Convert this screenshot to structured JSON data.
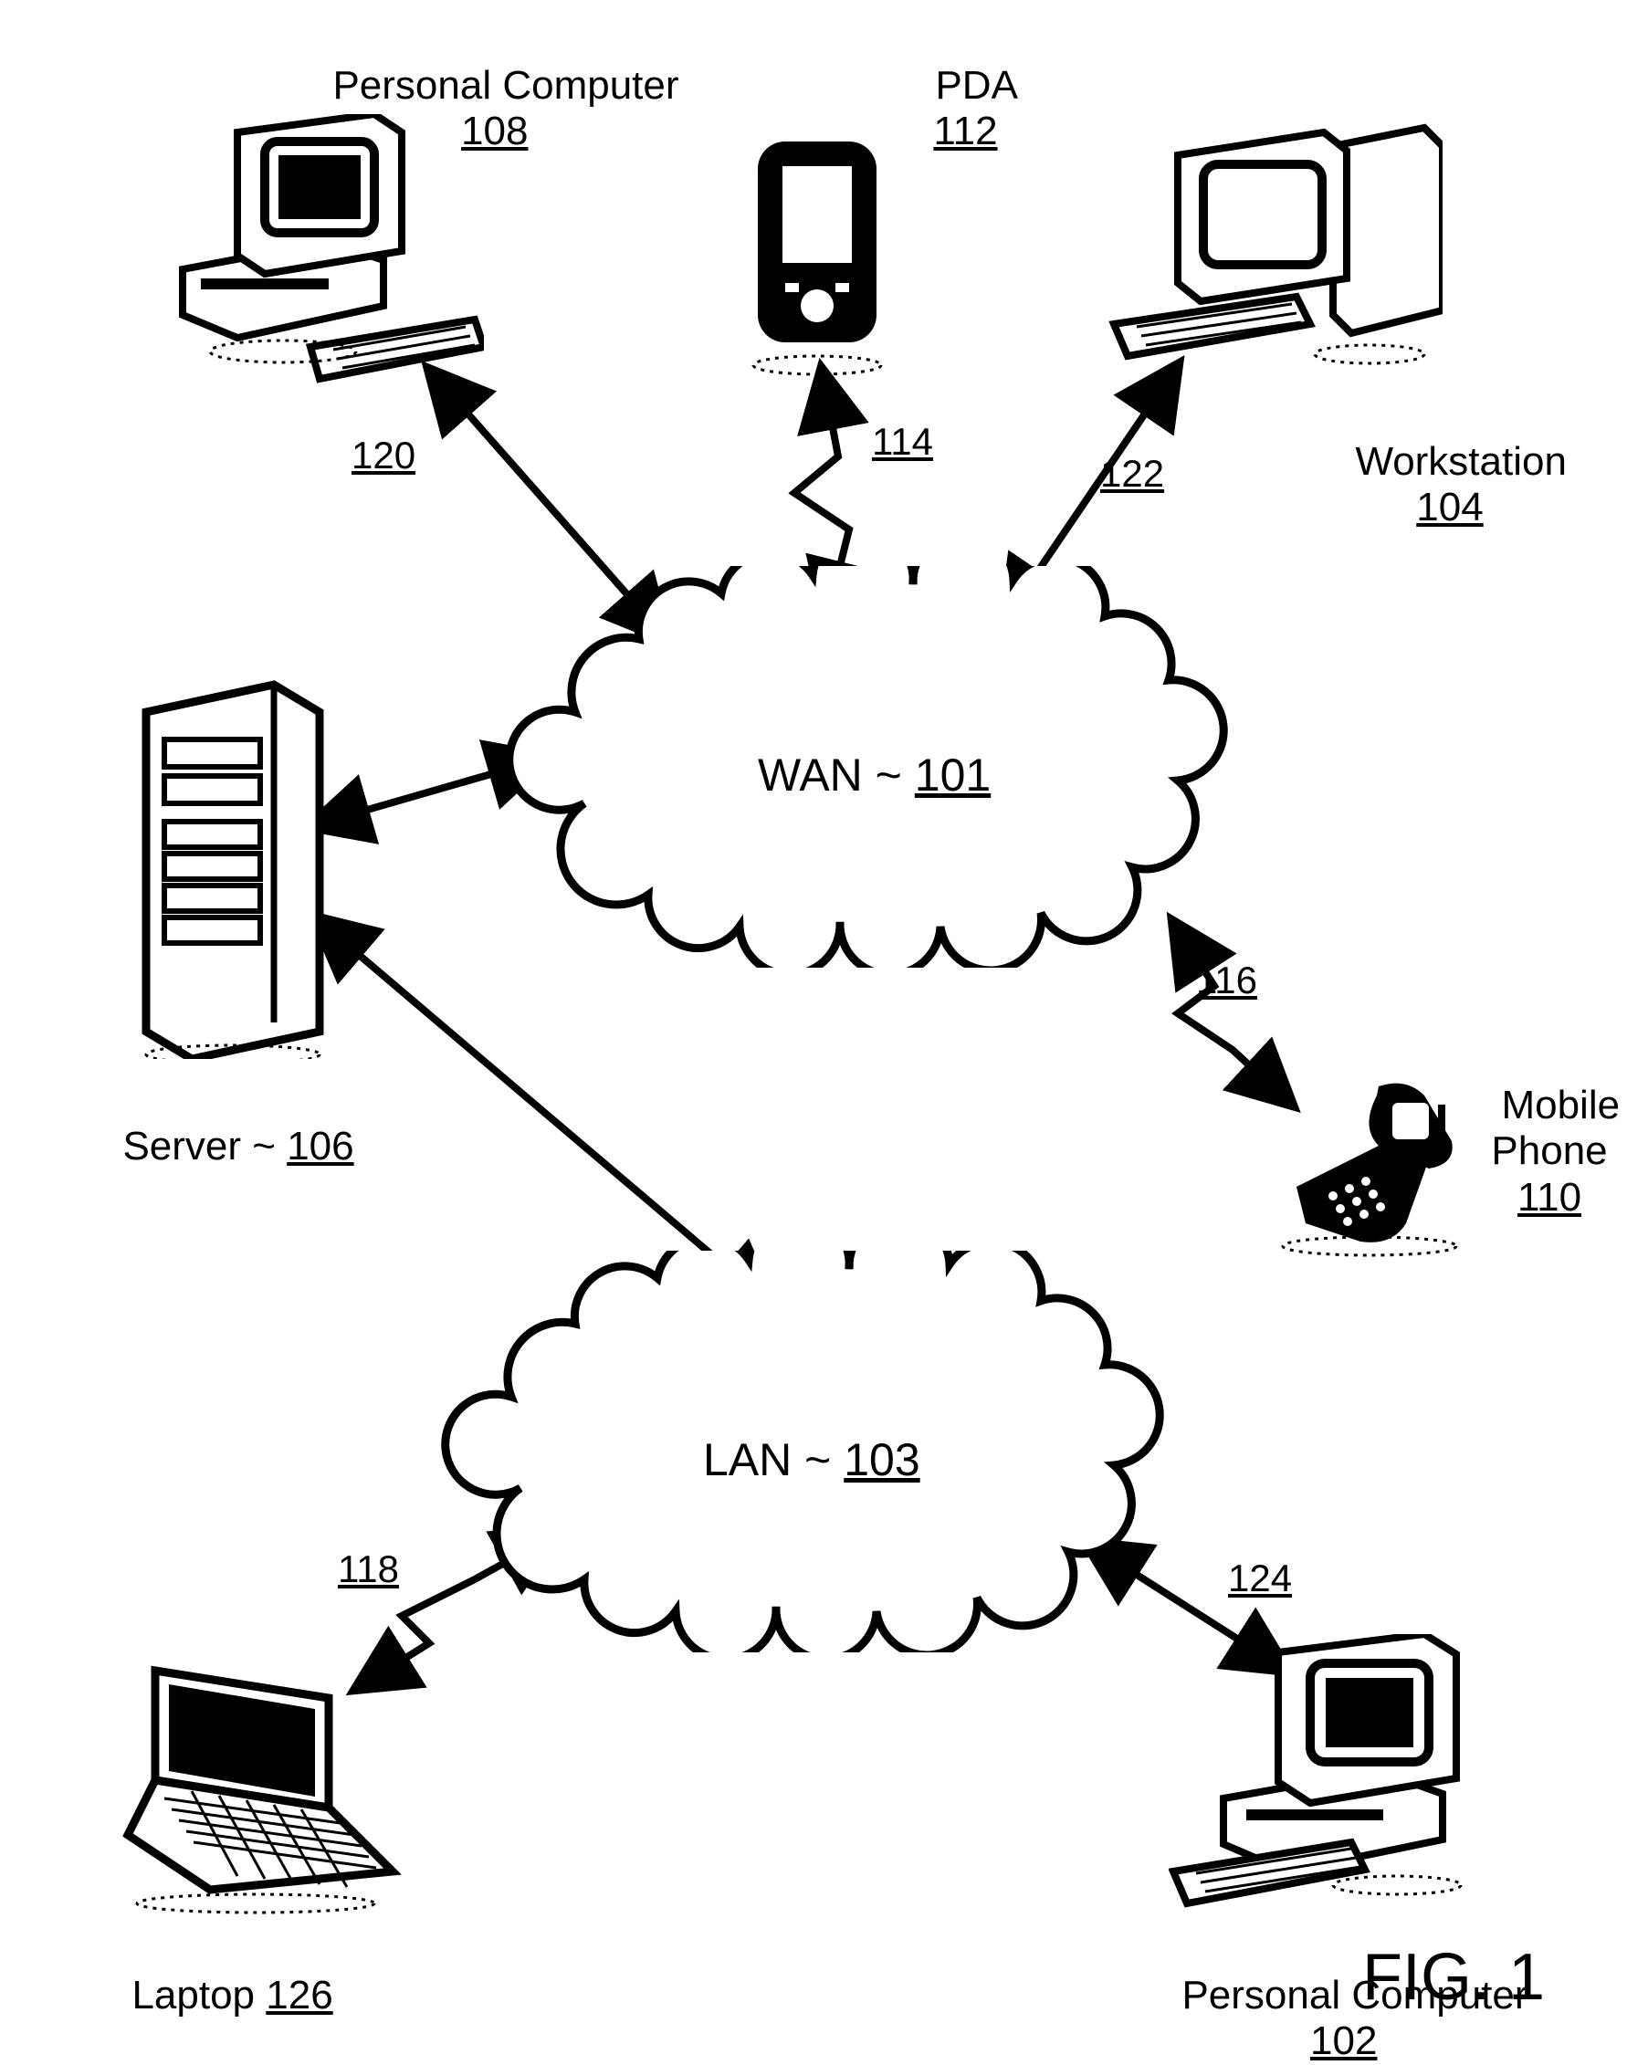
{
  "figure": "FIG. 1",
  "clouds": {
    "wan": {
      "prefix": "WAN ~ ",
      "ref": "101"
    },
    "lan": {
      "prefix": "LAN ~ ",
      "ref": "103"
    }
  },
  "nodes": {
    "pc_top": {
      "name": "Personal Computer",
      "ref": "108"
    },
    "pda": {
      "name": "PDA",
      "ref": "112"
    },
    "workstation": {
      "name": "Workstation",
      "ref": "104"
    },
    "server": {
      "name_prefix": "Server ~ ",
      "ref": "106"
    },
    "mobile": {
      "name": "Mobile\nPhone",
      "ref": "110"
    },
    "laptop": {
      "name_prefix": "Laptop ",
      "ref": "126"
    },
    "pc_bottom": {
      "name": "Personal Computer",
      "ref": "102"
    }
  },
  "edges": {
    "e120": "120",
    "e114": "114",
    "e122": "122",
    "e116": "116",
    "e118": "118",
    "e124": "124"
  }
}
